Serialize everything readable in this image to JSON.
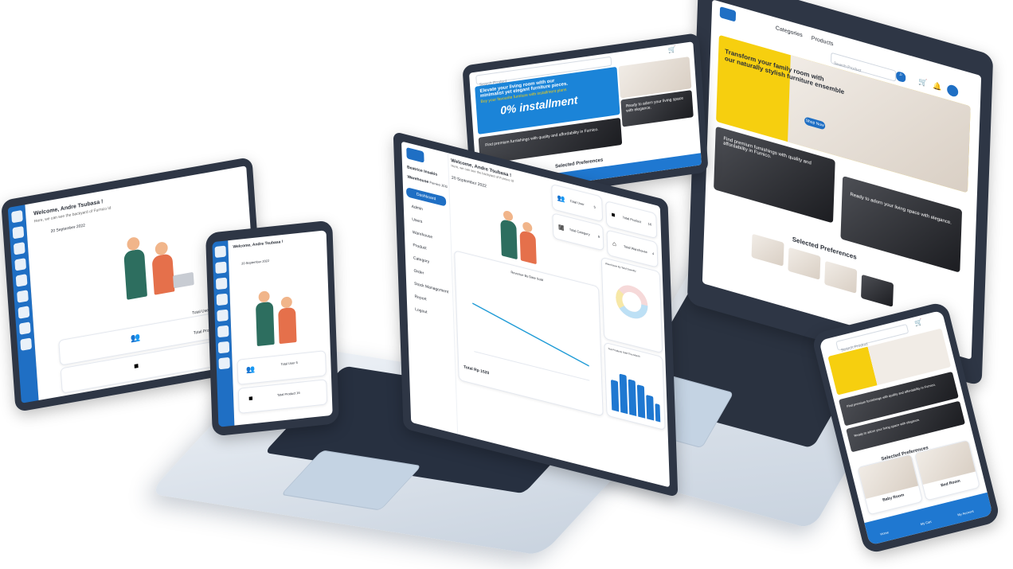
{
  "brand": {
    "accent": "#1f78d1",
    "accent_dark": "#1f6fc4",
    "yellow": "#f6cf0f",
    "frame": "#2e3645"
  },
  "dashboard": {
    "welcome": "Welcome, Andre Tsubasa !",
    "welcome_sub": "Here, we can see the backyard of Furnico Id",
    "date_label": "20 September 2022",
    "user_name": "Beatrice Insakis",
    "warehouse_label": "Warehouse",
    "warehouse_value": "Furnico JCG",
    "menu": [
      "Dashboard",
      "Admin",
      "Users",
      "Warehouse",
      "Product",
      "Category",
      "Order",
      "Stock Management",
      "Report",
      "Logout"
    ],
    "stats": [
      {
        "label": "Total User",
        "value": "5",
        "icon": "users-icon"
      },
      {
        "label": "Total Product",
        "value": "16",
        "icon": "box-icon"
      },
      {
        "label": "Total Category",
        "value": "9",
        "icon": "grid-icon"
      },
      {
        "label": "Total Warehouse",
        "value": "4",
        "icon": "warehouse-icon"
      }
    ],
    "line_chart_title": "Revenue By Date Sold",
    "line_chart_total": "Total Rp 1520",
    "donut_title": "Warehouse By Total Quantity",
    "bar_chart_title": "Top Products Sold This Month"
  },
  "tablet_left": {
    "welcome": "Welcome, Andre Tsubasa !",
    "sub": "Here, we can see the backyard of Furnico Id",
    "date": "20 September 2022",
    "stat1": "Total User 5",
    "stat2": "Total Product 16"
  },
  "phone_left": {
    "welcome": "Welcome, Andre Tsubasa !",
    "date": "20 September 2022",
    "stat1": "Total User 5",
    "stat2": "Total Product 16"
  },
  "tablet_top": {
    "search_placeholder": "Search Product",
    "banner_line1": "Elevate your living room with our",
    "banner_line2": "minimalist yet elegant furniture pieces.",
    "banner_line3": "Buy your favourite furniture with installment plans",
    "installment": "0% installment",
    "tile1": "Find premium furnishings with quality and affordability in Furnico.",
    "tile2": "Ready to adorn your living space with elegance.",
    "section": "Selected Preferences"
  },
  "laptop_right": {
    "nav_categories": "Categories",
    "nav_products": "Products",
    "search_placeholder": "Search Product",
    "hero_line1": "Transform your family room with",
    "hero_line2": "our naturally stylish furniture ensemble",
    "hero_button": "Shop Now",
    "tile1": "Find premium furnishings with quality and affordability in Furnico.",
    "tile2": "Ready to adorn your living space with elegance.",
    "section": "Selected Preferences"
  },
  "phone_right": {
    "search_placeholder": "Search Product",
    "tile1": "Find premium furnishings with quality and affordability in Furnico.",
    "tile2": "Ready to adorn your living space with elegance.",
    "section": "Selected Preferences",
    "pref1": "Baby Room",
    "pref2": "Bed Room",
    "nav": [
      "Home",
      "My Cart",
      "My Account"
    ]
  }
}
